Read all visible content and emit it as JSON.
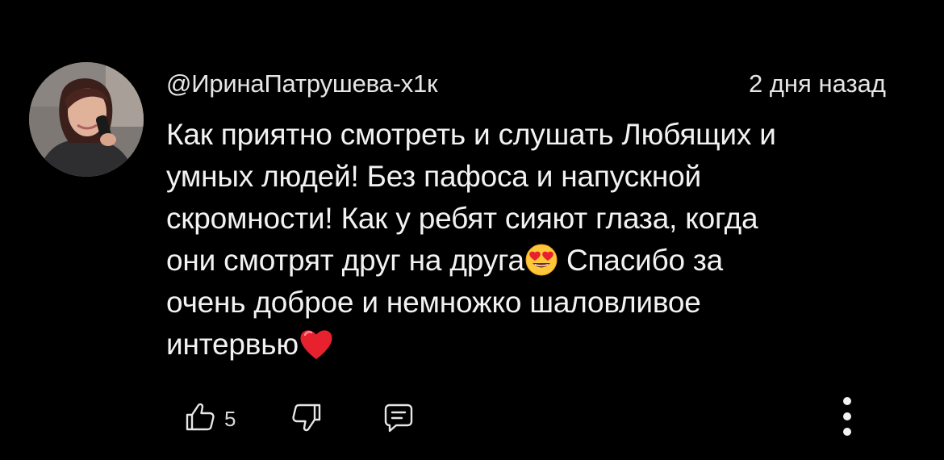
{
  "comment": {
    "author": "@ИринаПатрушева-х1к",
    "timestamp": "2 дня назад",
    "lines": [
      {
        "text": "Как приятно смотреть и слушать Любящих и"
      },
      {
        "text": "умных людей! Без пафоса и напускной"
      },
      {
        "text": "скромности! Как у ребят сияют глаза, когда"
      },
      {
        "text": "они смотрят друг на друга",
        "emoji_after": "heart-eyes",
        "rest": " Спасибо за"
      },
      {
        "text": "очень доброе и немножко шаловливое"
      },
      {
        "text": "интервью",
        "emoji_after": "red-heart"
      }
    ],
    "actions": {
      "like_icon": "thumbs-up-icon",
      "like_count": "5",
      "dislike_icon": "thumbs-down-icon",
      "reply_icon": "reply-comment-icon",
      "menu_icon": "more-vertical-icon"
    }
  },
  "colors": {
    "background": "#000000",
    "text": "#f2f2f2",
    "meta": "#e6e6e6",
    "heart": "#e8212e",
    "emoji_face": "#ffc83a"
  }
}
